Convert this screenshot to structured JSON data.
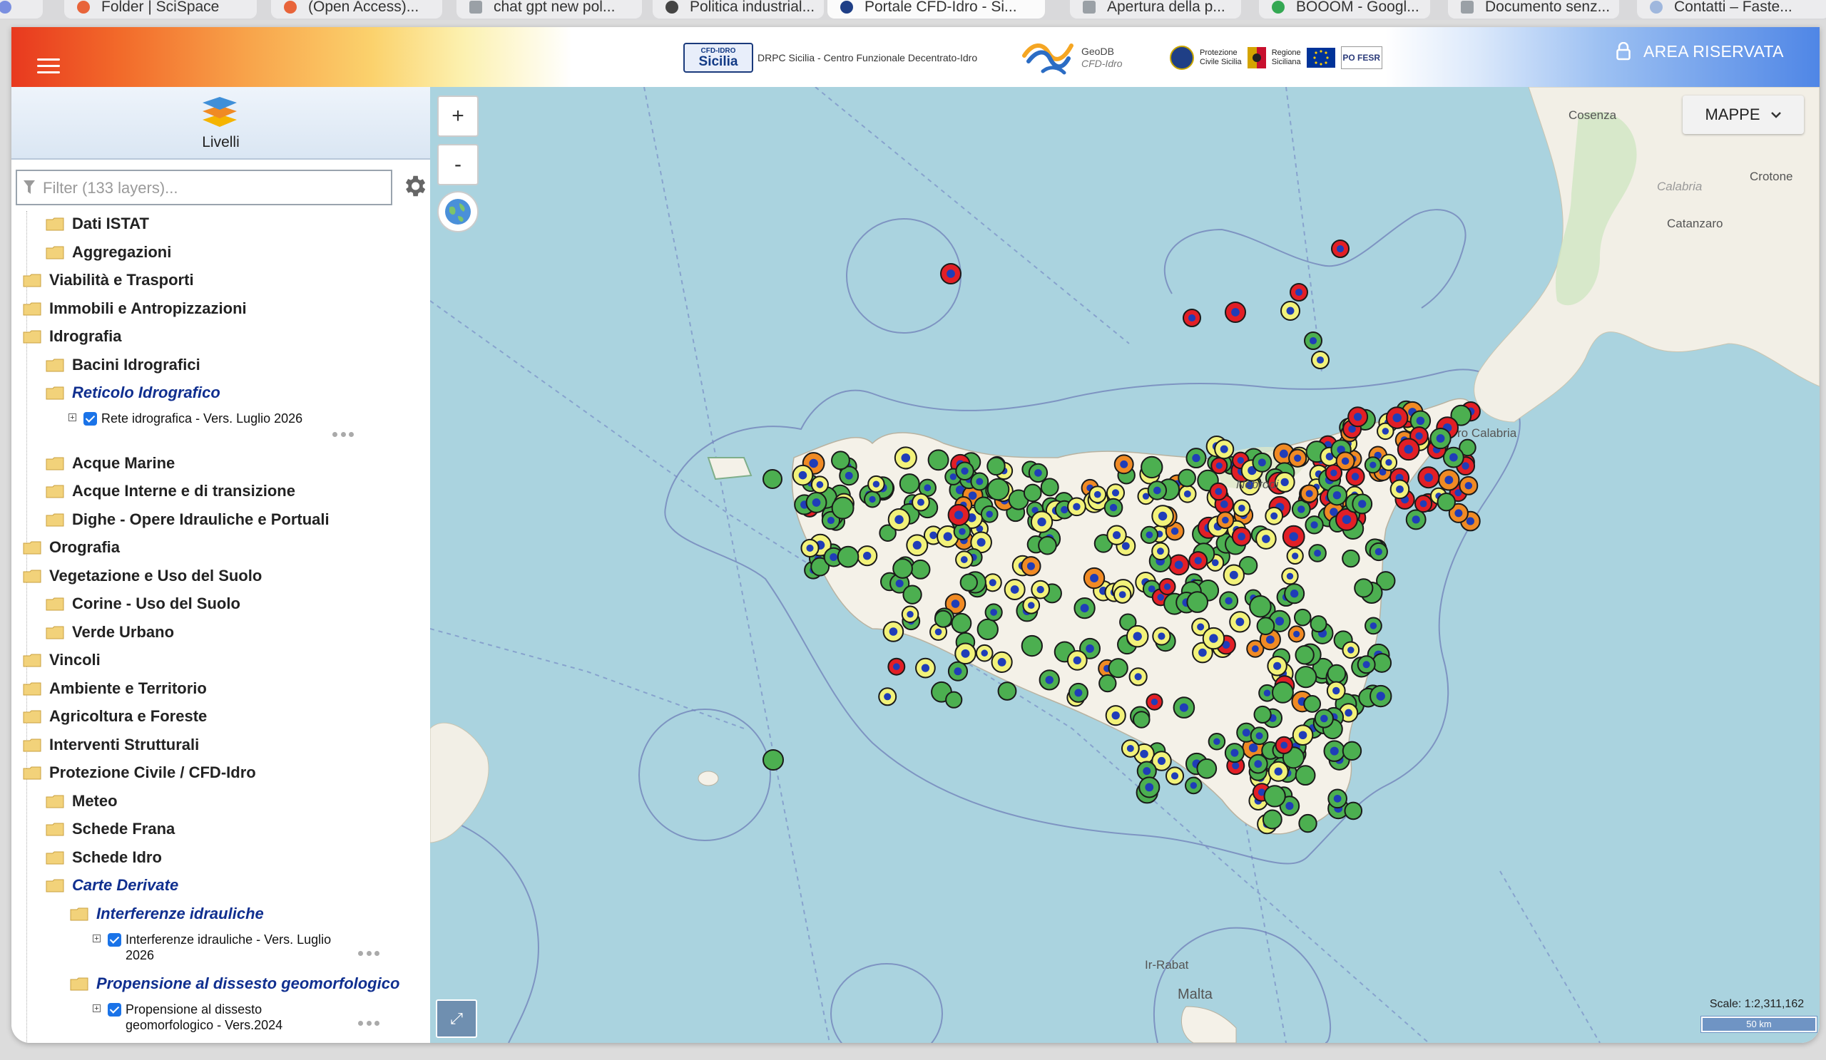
{
  "browser": {
    "tabs": [
      {
        "label": "Folder | SciSpace",
        "active": false
      },
      {
        "label": "(Open Access)...",
        "active": false
      },
      {
        "label": "chat gpt new pol...",
        "active": false
      },
      {
        "label": "Politica industrial...",
        "active": false
      },
      {
        "label": "Portale CFD-Idro - Si...",
        "active": true
      },
      {
        "label": "Apertura della p...",
        "active": false
      },
      {
        "label": "BOOOM - Googl...",
        "active": false
      },
      {
        "label": "Documento senz...",
        "active": false
      },
      {
        "label": "Contatti – Faste...",
        "active": false
      }
    ]
  },
  "header": {
    "cfd_small": "CFD-IDRO",
    "cfd_big": "Sicilia",
    "drpc_text": "DRPC Sicilia - Centro Funzionale Decentrato-Idro",
    "geodb_title": "GeoDB",
    "geodb_sub": "CFD-Idro",
    "pc_text": [
      "Protezione",
      "Civile Sicilia"
    ],
    "regione_text": [
      "Regione",
      "Siciliana"
    ],
    "po_text": "PO FESR",
    "area_riservata": "AREA RISERVATA",
    "accent_colors": [
      "#e8391f",
      "#fcf1b0",
      "#4f86e6"
    ]
  },
  "sidebar": {
    "tab_label": "Livelli",
    "filter_placeholder": "Filter (133 layers)...",
    "tree": {
      "dati_istat": "Dati ISTAT",
      "aggregazioni": "Aggregazioni",
      "viabilita": "Viabilità e Trasporti",
      "immobili": "Immobili e Antropizzazioni",
      "idrografia": "Idrografia",
      "bacini": "Bacini Idrografici",
      "reticolo": "Reticolo Idrografico",
      "rete_layer": "Rete idrografica - Vers. Luglio 2026",
      "acque_marine": "Acque Marine",
      "acque_interne": "Acque Interne e di transizione",
      "dighe": "Dighe - Opere Idrauliche e Portuali",
      "orografia": "Orografia",
      "vegetazione": "Vegetazione e Uso del Suolo",
      "corine": "Corine - Uso del Suolo",
      "verde": "Verde Urbano",
      "vincoli": "Vincoli",
      "ambiente": "Ambiente e Territorio",
      "agricoltura": "Agricoltura e Foreste",
      "interventi": "Interventi Strutturali",
      "protezione": "Protezione Civile / CFD-Idro",
      "meteo": "Meteo",
      "schede_frana": "Schede Frana",
      "schede_idro": "Schede Idro",
      "carte_derivate": "Carte Derivate",
      "interferenze": "Interferenze idrauliche",
      "interferenze_layer_1": "Interferenze idrauliche - Vers. Luglio",
      "interferenze_layer_2": "2026",
      "propensione": "Propensione al dissesto geomorfologico",
      "propensione_layer_1": "Propensione al dissesto",
      "propensione_layer_2": "geomorfologico - Vers.2024"
    }
  },
  "map": {
    "zoom_in": "+",
    "zoom_out": "-",
    "basemap_button": "MAPPE",
    "scale_text": "Scale: 1:2,311,162",
    "scalebar_text": "50 km",
    "places": {
      "cosenza": "Cosenza",
      "crotone": "Crotone",
      "calabria": "Calabria",
      "catanzaro": "Catanzaro",
      "malta": "Malta",
      "irrabat": "Ir-Rabat",
      "nebrodi": "Nebrodi",
      "calabria_s": "ro Calabria"
    },
    "marker_colors": {
      "green": "#4caf50",
      "yellow": "#f2f27a",
      "orange": "#f08a24",
      "red": "#e21f26",
      "center": "#1f3db8"
    }
  }
}
